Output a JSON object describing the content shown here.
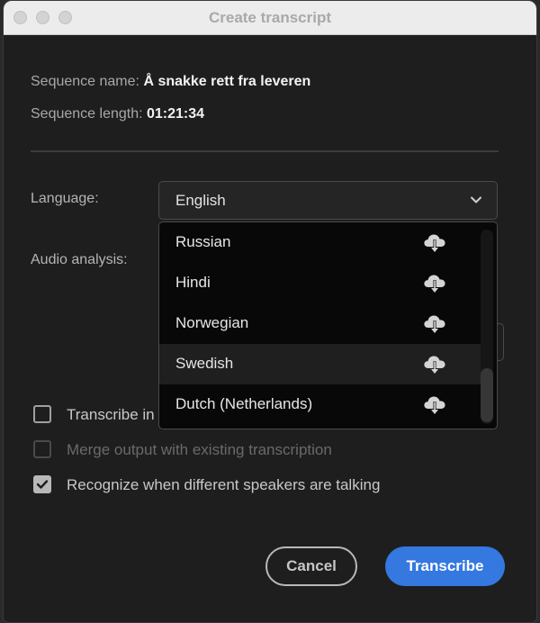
{
  "window": {
    "title": "Create transcript"
  },
  "sequence": {
    "name_label": "Sequence name:",
    "name_value": "Å snakke rett fra leveren",
    "length_label": "Sequence length:",
    "length_value": "01:21:34"
  },
  "language": {
    "label": "Language:",
    "selected": "English",
    "options": [
      {
        "name": "Russian",
        "icon": "cloud-download-icon",
        "highlighted": false
      },
      {
        "name": "Hindi",
        "icon": "cloud-download-icon",
        "highlighted": false
      },
      {
        "name": "Norwegian",
        "icon": "cloud-download-icon",
        "highlighted": false
      },
      {
        "name": "Swedish",
        "icon": "cloud-download-icon",
        "highlighted": true
      },
      {
        "name": "Dutch (Netherlands)",
        "icon": "cloud-download-icon",
        "highlighted": false
      }
    ]
  },
  "audio_analysis": {
    "label": "Audio analysis:"
  },
  "options": [
    {
      "label": "Transcribe in",
      "checked": false,
      "disabled": false
    },
    {
      "label": "Merge output with existing transcription",
      "checked": false,
      "disabled": true
    },
    {
      "label": "Recognize when different speakers are talking",
      "checked": true,
      "disabled": false
    }
  ],
  "buttons": {
    "cancel": "Cancel",
    "transcribe": "Transcribe"
  },
  "colors": {
    "primary": "#3478e0",
    "background": "#1e1e1e",
    "dropdown_bg": "#080808",
    "highlight_bg": "#1f1f1f"
  }
}
